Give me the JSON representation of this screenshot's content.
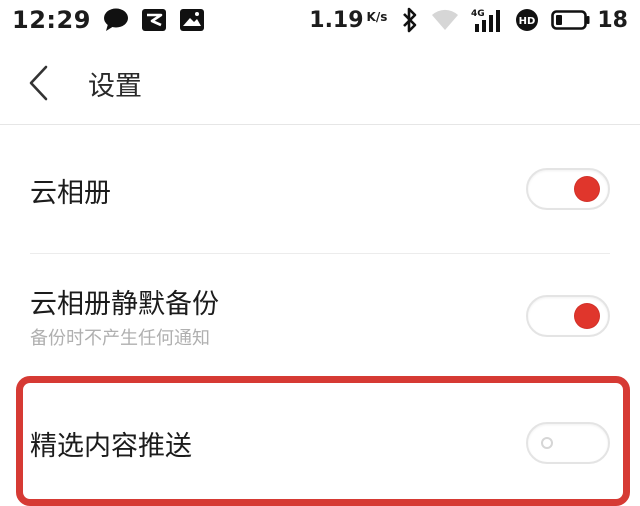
{
  "status_bar": {
    "time": "12:29",
    "speed_value": "1.19",
    "speed_unit": "K/s",
    "battery_percent": "18",
    "icons": [
      "message-icon",
      "app-icon",
      "image-icon",
      "bluetooth-icon",
      "wifi-icon",
      "signal-4g-icon",
      "hd-icon",
      "battery-icon"
    ],
    "network_label": "4G",
    "hd_label": "HD"
  },
  "header": {
    "title": "设置"
  },
  "settings": [
    {
      "label": "云相册",
      "subtitle": "",
      "enabled": true
    },
    {
      "label": "云相册静默备份",
      "subtitle": "备份时不产生任何通知",
      "enabled": true
    },
    {
      "label": "精选内容推送",
      "subtitle": "",
      "enabled": false
    }
  ],
  "colors": {
    "accent": "#e0362c",
    "highlight_border": "#d63a34",
    "subtitle": "#b0b0b0"
  }
}
